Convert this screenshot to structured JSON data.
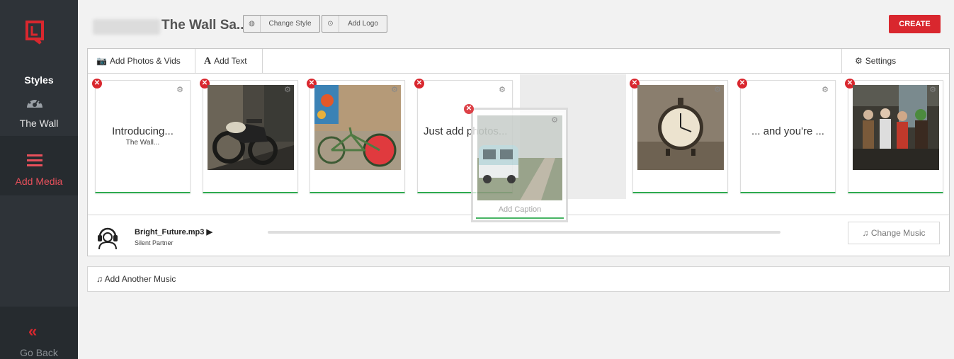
{
  "app": {
    "accent_color": "#d9272e"
  },
  "sidebar": {
    "logo_icon": "brand-logo-icon",
    "styles_label": "Styles",
    "wall_label": "The Wall",
    "wall_icon": "dashboard-gauge-icon",
    "add_media_label": "Add Media",
    "add_media_icon": "hamburger-menu-icon",
    "go_back_label": "Go Back",
    "go_back_icon": "double-chevron-left-icon"
  },
  "header": {
    "title": "The Wall Sa...",
    "change_style_label": "Change Style",
    "add_logo_label": "Add Logo",
    "create_label": "CREATE"
  },
  "toolbar": {
    "add_photos_label": "Add Photos & Vids",
    "add_text_label": "Add Text",
    "settings_label": "Settings"
  },
  "slides": [
    {
      "type": "text",
      "title": "Introducing...",
      "subtitle": "The Wall..."
    },
    {
      "type": "photo",
      "photo": "motorcycle-photo"
    },
    {
      "type": "photo",
      "photo": "bicycle-photo"
    },
    {
      "type": "text",
      "title": "Just add photos...",
      "subtitle": ""
    },
    {
      "type": "photo",
      "photo": "alarm-clock-photo"
    },
    {
      "type": "text",
      "title": "... and you're ...",
      "subtitle": ""
    },
    {
      "type": "photo",
      "photo": "costume-group-photo"
    }
  ],
  "dragged_slide": {
    "photo": "vw-van-photo",
    "caption_placeholder": "Add Caption"
  },
  "music": {
    "track": "Bright_Future.mp3 ▶",
    "artist": "Silent Partner",
    "progress": 0,
    "change_label": "Change Music"
  },
  "add_music": {
    "label": "Add Another Music"
  }
}
